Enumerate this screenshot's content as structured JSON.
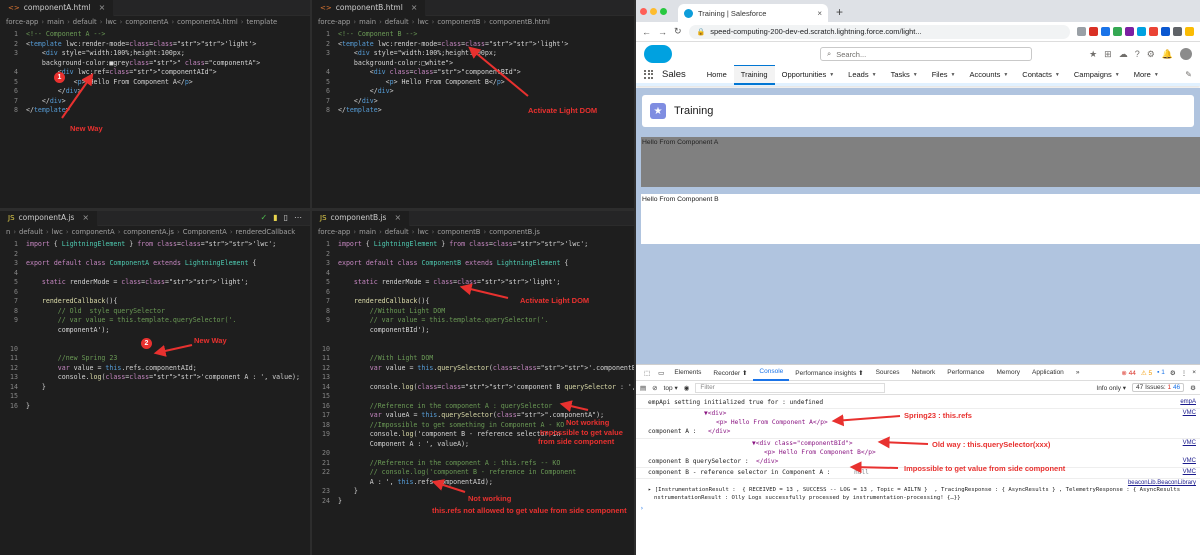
{
  "top_left": {
    "tab": "componentA.html",
    "crumbs": [
      "force-app",
      "main",
      "default",
      "lwc",
      "componentA",
      "componentA.html",
      "template"
    ],
    "lines": [
      {
        "n": "1",
        "t": "<!-- Component A -->"
      },
      {
        "n": "2",
        "t": "<template lwc:render-mode='light'>"
      },
      {
        "n": "3",
        "t": "    <div style=\"width:100%;height:100px;"
      },
      {
        "n": "",
        "t": "    background-color:■grey\" class=\"componentA\">"
      },
      {
        "n": "4",
        "t": "        <div lwc:ref=\"componentAId\">"
      },
      {
        "n": "5",
        "t": "            <p> Hello From Component A</p>"
      },
      {
        "n": "6",
        "t": "        </div>"
      },
      {
        "n": "7",
        "t": "    </div>"
      },
      {
        "n": "8",
        "t": "</template>"
      }
    ],
    "annotation": "New Way",
    "badge": "1"
  },
  "top_right": {
    "tab": "componentB.html",
    "crumbs": [
      "force-app",
      "main",
      "default",
      "lwc",
      "componentB",
      "componentB.html"
    ],
    "lines": [
      {
        "n": "1",
        "t": "<!-- Component B -->"
      },
      {
        "n": "2",
        "t": "<template lwc:render-mode='light'>"
      },
      {
        "n": "3",
        "t": "    <div style=\"width:100%;height:100px;"
      },
      {
        "n": "",
        "t": "    background-color:□white\">"
      },
      {
        "n": "4",
        "t": "        <div class=\"componentBId\">"
      },
      {
        "n": "5",
        "t": "            <p> Hello From Component B</p>"
      },
      {
        "n": "6",
        "t": "        </div>"
      },
      {
        "n": "7",
        "t": "    </div>"
      },
      {
        "n": "8",
        "t": "</template>"
      }
    ],
    "annotation": "Activate Light DOM"
  },
  "bottom_left": {
    "tab": "componentA.js",
    "crumbs": [
      "n",
      "default",
      "lwc",
      "componentA",
      "componentA.js",
      "ComponentA",
      "renderedCallback"
    ],
    "lines": [
      {
        "n": "1",
        "t": "import { LightningElement } from 'lwc';"
      },
      {
        "n": "2",
        "t": ""
      },
      {
        "n": "3",
        "t": "export default class ComponentA extends LightningElement {"
      },
      {
        "n": "4",
        "t": ""
      },
      {
        "n": "5",
        "t": "    static renderMode = 'light';"
      },
      {
        "n": "6",
        "t": ""
      },
      {
        "n": "7",
        "t": "    renderedCallback(){"
      },
      {
        "n": "8",
        "t": "        // Old  style querySelector"
      },
      {
        "n": "9",
        "t": "        // var value = this.template.querySelector('."
      },
      {
        "n": "",
        "t": "        componentA');"
      },
      {
        "n": "",
        "t": ""
      },
      {
        "n": "10",
        "t": ""
      },
      {
        "n": "11",
        "t": "        //new Spring 23"
      },
      {
        "n": "12",
        "t": "        var value = this.refs.componentAId;"
      },
      {
        "n": "13",
        "t": "        console.log('component A : ', value);"
      },
      {
        "n": "14",
        "t": "    }"
      },
      {
        "n": "15",
        "t": ""
      },
      {
        "n": "16",
        "t": "}"
      }
    ],
    "annotation": "New Way",
    "badge": "2"
  },
  "bottom_right": {
    "tab": "componentB.js",
    "crumbs": [
      "force-app",
      "main",
      "default",
      "lwc",
      "componentB",
      "componentB.js"
    ],
    "lines": [
      {
        "n": "1",
        "t": "import { LightningElement } from 'lwc';"
      },
      {
        "n": "2",
        "t": ""
      },
      {
        "n": "3",
        "t": "export default class ComponentB extends LightningElement {"
      },
      {
        "n": "4",
        "t": ""
      },
      {
        "n": "5",
        "t": "    static renderMode = 'light';"
      },
      {
        "n": "6",
        "t": ""
      },
      {
        "n": "7",
        "t": "    renderedCallback(){"
      },
      {
        "n": "8",
        "t": "        //Without Light DOM"
      },
      {
        "n": "9",
        "t": "        // var value = this.template.querySelector('."
      },
      {
        "n": "",
        "t": "        componentBId');"
      },
      {
        "n": "",
        "t": ""
      },
      {
        "n": "10",
        "t": ""
      },
      {
        "n": "11",
        "t": "        //With Light DOM"
      },
      {
        "n": "12",
        "t": "        var value = this.querySelector('.componentBId');"
      },
      {
        "n": "13",
        "t": ""
      },
      {
        "n": "14",
        "t": "        console.log('component B querySelector : ', value);"
      },
      {
        "n": "15",
        "t": ""
      },
      {
        "n": "16",
        "t": "        //Reference in the component A : querySelector"
      },
      {
        "n": "17",
        "t": "        var valueA = this.querySelector(\".componentA\");"
      },
      {
        "n": "18",
        "t": "        //Impossible to get something in Component A - KO"
      },
      {
        "n": "19",
        "t": "        console.log('component B - reference selector in"
      },
      {
        "n": "",
        "t": "        Component A : ', valueA);"
      },
      {
        "n": "20",
        "t": ""
      },
      {
        "n": "21",
        "t": "        //Reference in the component A : this.refs -- KO"
      },
      {
        "n": "22",
        "t": "        // console.log('component B - reference in Component"
      },
      {
        "n": "",
        "t": "        A : ', this.refs.componentAId);"
      },
      {
        "n": "23",
        "t": "    }"
      },
      {
        "n": "24",
        "t": "}"
      }
    ],
    "ann_light": "Activate Light DOM",
    "ann_notworking1": "Not working",
    "ann_impossible": "Impossible to get value",
    "ann_from_side": "from side component",
    "ann_notworking2": "Not working",
    "ann_refs": "this.refs not allowed to get value from side component"
  },
  "browser": {
    "tab_title": "Training | Salesforce",
    "url": "speed-computing-200-dev-ed.scratch.lightning.force.com/light...",
    "search_placeholder": "Search...",
    "app_name": "Sales",
    "nav": [
      {
        "label": "Home",
        "chev": false
      },
      {
        "label": "Training",
        "chev": false
      },
      {
        "label": "Opportunities",
        "chev": true
      },
      {
        "label": "Leads",
        "chev": true
      },
      {
        "label": "Tasks",
        "chev": true
      },
      {
        "label": "Files",
        "chev": true
      },
      {
        "label": "Accounts",
        "chev": true
      },
      {
        "label": "Contacts",
        "chev": true
      },
      {
        "label": "Campaigns",
        "chev": true
      },
      {
        "label": "More",
        "chev": true
      }
    ],
    "page_title": "Training",
    "compA_text": "Hello From Component A",
    "compB_text": "Hello From Component B"
  },
  "devtools": {
    "tabs": [
      "Elements",
      "Recorder ⬆",
      "Console",
      "Performance insights ⬆",
      "Sources",
      "Network",
      "Performance",
      "Memory",
      "Application",
      "»"
    ],
    "errors": "44",
    "warnings": "5",
    "infos": "1",
    "context": "top",
    "filter_placeholder": "Filter",
    "levels": "Info only",
    "issues_label": "47 Issues:",
    "issues_err": "1",
    "issues_info": "46",
    "lines": {
      "l1": "empApi setting initialized true for : undefined",
      "l1_src": "empA",
      "l2": "▼<div>",
      "l3": "<p> Hello From Component A</p>",
      "l4a": "component A : ",
      "l4b": "</div>",
      "l5": "▼<div class=\"componentBId\">",
      "l6": "<p> Hello From Component B</p>",
      "l7a": "component B querySelector : ",
      "l7b": "</div>",
      "l8a": "component B - reference selector in Component A : ",
      "l8b": "null",
      "l9_src": "beaconLib.BeaconLibrary",
      "l9": "▸ [InstrumentationResult :  { RECEIVED = 13 , SUCCESS -- LOG = 13 , Topic = AILTN }  , TracingResponse : { AsyncResults } , TelemetryResponse : { AsyncResults",
      "l10": "nstrumentationResult : Olly Logs successfully processed by instrumentation-processing! {…}}",
      "src_vmc": "VMC"
    },
    "ann_spring": "Spring23 : this.refs",
    "ann_old": "Old way : this.querySelector(xxx)",
    "ann_impossible": "Impossible to get value from side component"
  }
}
